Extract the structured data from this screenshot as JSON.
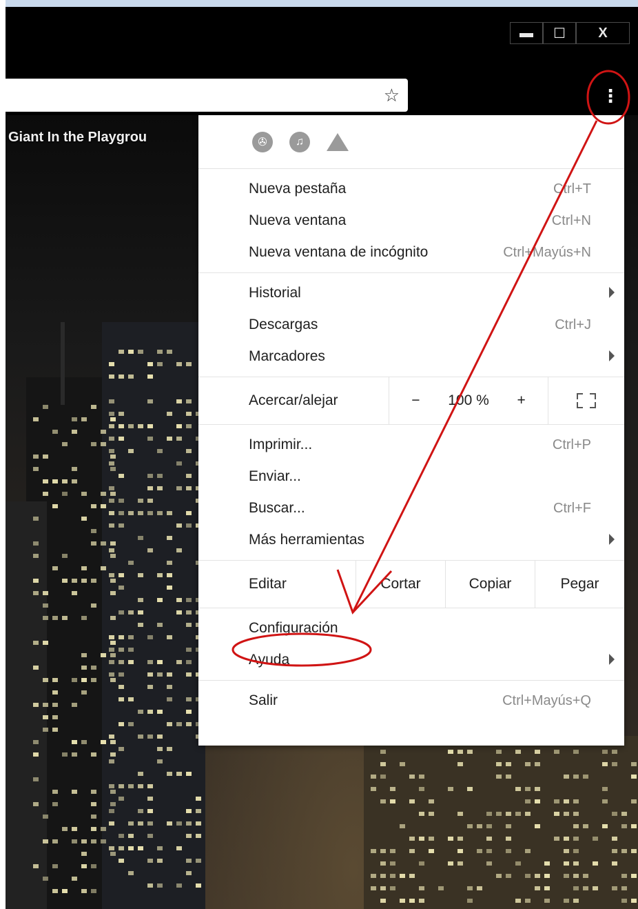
{
  "window": {
    "controls": {
      "minimize": "▬",
      "maximize": "☐",
      "close": "X"
    }
  },
  "page": {
    "tab_title": "Giant In the Playgrou"
  },
  "toolbar": {
    "star_icon": "star-icon",
    "menu_icon": "kebab-menu-icon"
  },
  "menu": {
    "extensions": [
      "film-extension-icon",
      "vinyl-extension-icon",
      "drive-icon"
    ],
    "group1": [
      {
        "label": "Nueva pestaña",
        "shortcut": "Ctrl+T"
      },
      {
        "label": "Nueva ventana",
        "shortcut": "Ctrl+N"
      },
      {
        "label": "Nueva ventana de incógnito",
        "shortcut": "Ctrl+Mayús+N"
      }
    ],
    "group2": [
      {
        "label": "Historial",
        "shortcut": ""
      },
      {
        "label": "Descargas",
        "shortcut": "Ctrl+J"
      },
      {
        "label": "Marcadores",
        "shortcut": ""
      }
    ],
    "zoom": {
      "label": "Acercar/alejar",
      "minus": "−",
      "value": "100 %",
      "plus": "+"
    },
    "group3": [
      {
        "label": "Imprimir...",
        "shortcut": "Ctrl+P"
      },
      {
        "label": "Enviar...",
        "shortcut": ""
      },
      {
        "label": "Buscar...",
        "shortcut": "Ctrl+F"
      },
      {
        "label": "Más herramientas",
        "shortcut": ""
      }
    ],
    "edit": {
      "label": "Editar",
      "cut": "Cortar",
      "copy": "Copiar",
      "paste": "Pegar"
    },
    "group4": [
      {
        "label": "Configuración",
        "shortcut": ""
      },
      {
        "label": "Ayuda",
        "shortcut": ""
      }
    ],
    "group5": [
      {
        "label": "Salir",
        "shortcut": "Ctrl+Mayús+Q"
      }
    ]
  },
  "annotation": {
    "color": "#d01414"
  }
}
